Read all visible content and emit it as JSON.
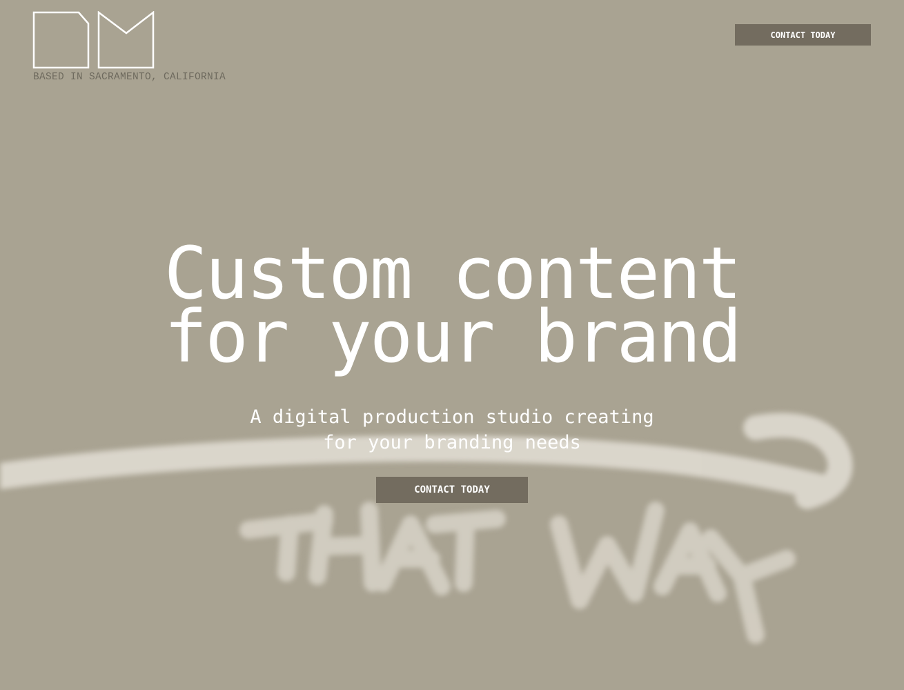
{
  "header": {
    "logo_alt": "DM",
    "location": "BASED IN SACRAMENTO, CALIFORNIA",
    "cta_label": "CONTACT TODAY"
  },
  "hero": {
    "headline_line1": "Custom content",
    "headline_line2": "for your brand",
    "sub_line1": "A digital production studio creating",
    "sub_line2": "for your branding needs",
    "cta_label": "CONTACT TODAY",
    "background_graffiti": "THAT WAY"
  },
  "colors": {
    "background": "#a9a392",
    "button": "#736c5f",
    "text": "#ffffff",
    "muted_text": "#6e6a5e"
  }
}
